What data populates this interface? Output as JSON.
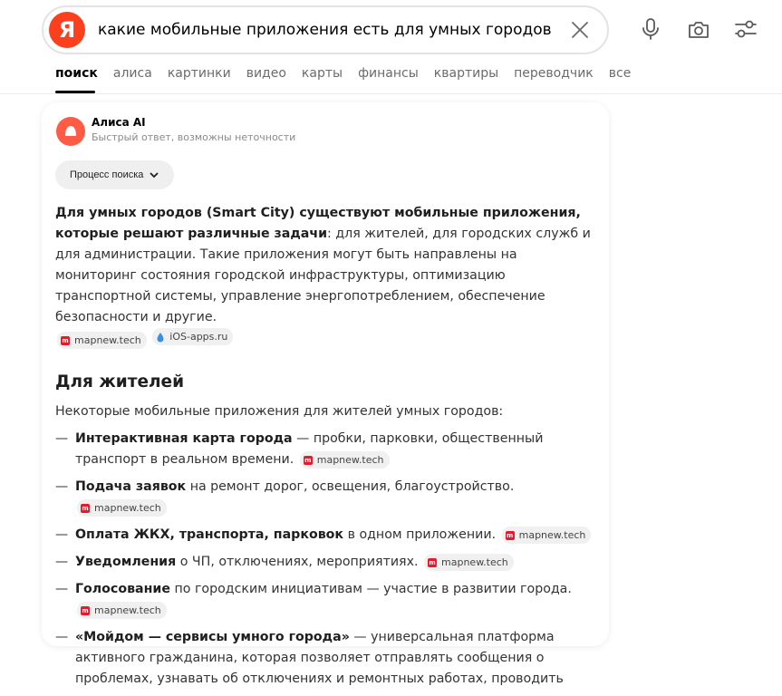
{
  "header": {
    "logo_letter": "Я",
    "query": "какие мобильные приложения есть для умных городов"
  },
  "tabs": [
    {
      "label": "поиск",
      "active": true
    },
    {
      "label": "алиса"
    },
    {
      "label": "картинки"
    },
    {
      "label": "видео"
    },
    {
      "label": "карты"
    },
    {
      "label": "финансы"
    },
    {
      "label": "квартиры"
    },
    {
      "label": "переводчик"
    },
    {
      "label": "все"
    }
  ],
  "answer": {
    "title": "Алиса AI",
    "subtitle": "Быстрый ответ, возможны неточности",
    "process_label": "Процесс поиска",
    "intro_bold": "Для умных городов (Smart City) существуют мобильные приложения, которые решают различные задачи",
    "intro_rest": ": для жителей, для городских служб и для администрации. Такие приложения могут быть направлены на мониторинг состояния городской инфраструктуры, оптимизацию транспортной системы, управление энергопотреблением, обеспечение безопасности и другие.",
    "intro_sources": [
      "mapnew.tech",
      "iOS-apps.ru"
    ],
    "section_title": "Для жителей",
    "section_lead": "Некоторые мобильные приложения для жителей умных городов:",
    "items": [
      {
        "bold": "Интерактивная карта города",
        "text": " — пробки, парковки, общественный транспорт в реальном времени.",
        "source": "mapnew.tech"
      },
      {
        "bold": "Подача заявок",
        "text": " на ремонт дорог, освещения, благоустройство.",
        "source": "mapnew.tech"
      },
      {
        "bold": "Оплата ЖКХ, транспорта, парковок",
        "text": " в одном приложении.",
        "source": "mapnew.tech"
      },
      {
        "bold": "Уведомления",
        "text": " о ЧП, отключениях, мероприятиях.",
        "source": "mapnew.tech"
      },
      {
        "bold": "Голосование",
        "text": " по городским инициативам — участие в развитии города.",
        "source": "mapnew.tech"
      },
      {
        "bold": "«Мойдом — сервисы умного города»",
        "text": " — универсальная платформа активного гражданина, которая позволяет отправлять сообщения о проблемах, узнавать об отключениях и ремонтных работах, проводить",
        "source": ""
      }
    ]
  },
  "colors": {
    "brand": "#fc3f1d",
    "alice": "#ff5b45",
    "source_icon": "#e8192c"
  }
}
